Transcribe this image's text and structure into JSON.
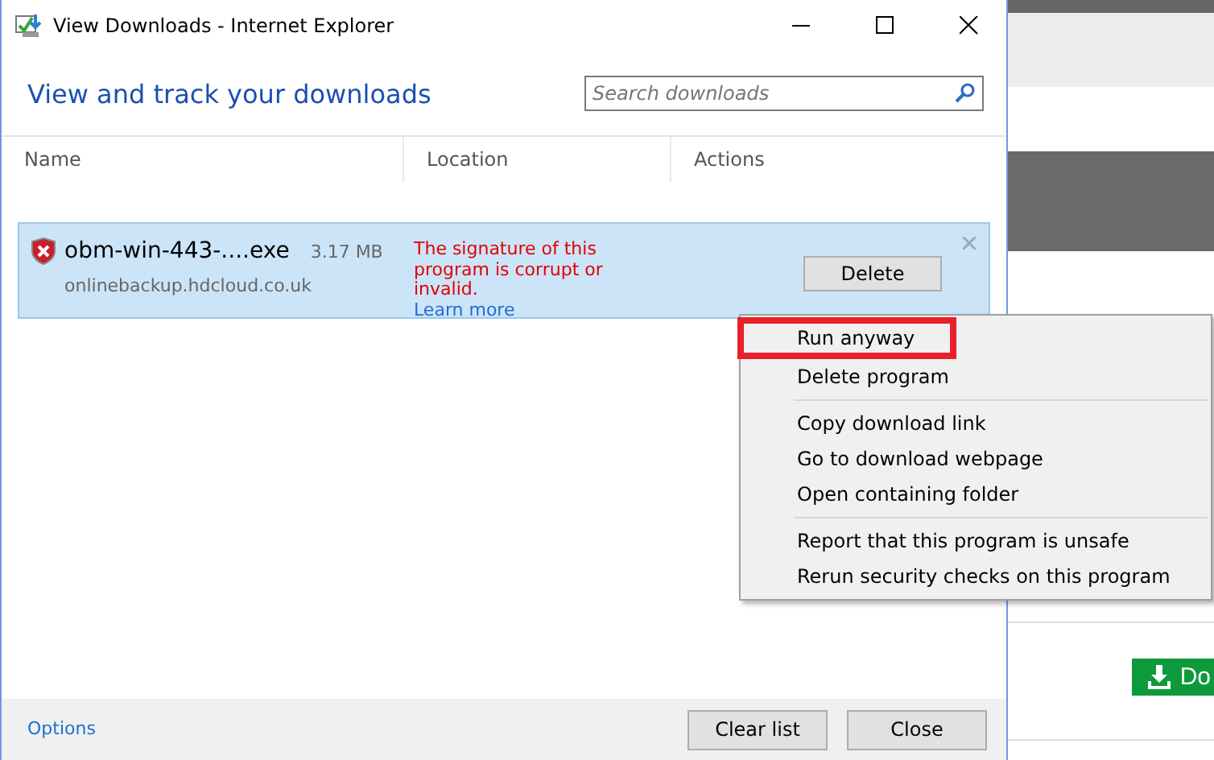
{
  "window": {
    "title": "View Downloads - Internet Explorer"
  },
  "heading": "View and track your downloads",
  "search": {
    "placeholder": "Search downloads"
  },
  "columns": [
    "Name",
    "Location",
    "Actions"
  ],
  "downloads": [
    {
      "name": "obm-win-443-....exe",
      "size": "3.17 MB",
      "source": "onlinebackup.hdcloud.co.uk",
      "warning": "The signature of this program is corrupt or invalid.",
      "link": "Learn more",
      "action": "Delete",
      "selected": true
    }
  ],
  "menu": {
    "groups": [
      [
        {
          "label": "Run anyway",
          "highlighted": true
        },
        {
          "label": "Delete program",
          "highlighted": false
        }
      ],
      [
        {
          "label": "Copy download link",
          "highlighted": false
        },
        {
          "label": "Go to download webpage",
          "highlighted": false
        },
        {
          "label": "Open containing folder",
          "highlighted": false
        }
      ],
      [
        {
          "label": "Report that this program is unsafe",
          "highlighted": false
        },
        {
          "label": "Rerun security checks on this program",
          "highlighted": false
        }
      ]
    ]
  },
  "footer": {
    "link": "Options",
    "buttons": [
      "Clear list",
      "Close"
    ]
  },
  "background_page": {
    "button": "Do"
  }
}
